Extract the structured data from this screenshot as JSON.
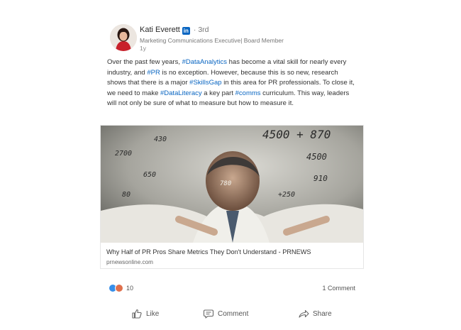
{
  "author": {
    "name": "Kati Everett",
    "badge": "in",
    "degree": "· 3rd",
    "headline": "Marketing Communications Executive| Board Member",
    "time": "1y"
  },
  "post": {
    "s1": "Over the past few years, ",
    "tag1": "#DataAnalytics",
    "s2": " has become a vital skill for nearly every industry, and ",
    "tag2": "#PR",
    "s3": " is no exception. However, because this is so new, research shows that there is a major ",
    "tag3": "#SkillsGap",
    "s4": " in this area for PR professionals. To close it, we need to make ",
    "tag4": "#DataLiteracy",
    "s5": " a key part ",
    "tag5": "#comms",
    "s6": " curriculum. This way, leaders will not only be sure of what to measure but how to measure it."
  },
  "link_card": {
    "title": "Why Half of PR Pros Share Metrics They Don't Understand - PRNEWS",
    "source": "prnewsonline.com",
    "image_text": [
      "4500 + 870",
      "4500",
      "2700",
      "650",
      "910",
      "+250",
      "80",
      "430",
      "780"
    ]
  },
  "social": {
    "reaction_count": "10",
    "comments": "1 Comment"
  },
  "actions": {
    "like": "Like",
    "comment": "Comment",
    "share": "Share"
  },
  "colors": {
    "link": "#0a66c2",
    "like_reaction": "#378fe9",
    "love_reaction": "#df704d"
  }
}
